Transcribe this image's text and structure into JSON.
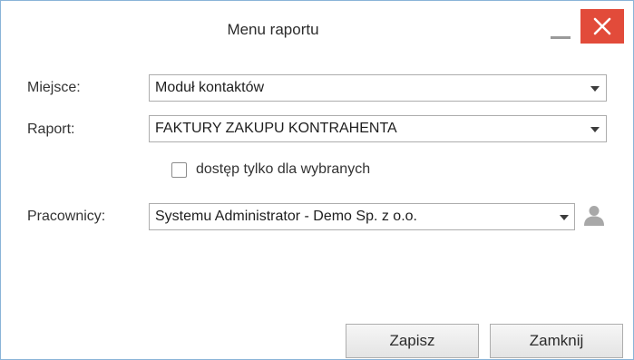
{
  "window": {
    "title": "Menu raportu"
  },
  "form": {
    "miejsce": {
      "label": "Miejsce:",
      "value": "Moduł kontaktów"
    },
    "raport": {
      "label": "Raport:",
      "value": "FAKTURY ZAKUPU KONTRAHENTA"
    },
    "access_checkbox": {
      "label": "dostęp tylko dla wybranych",
      "checked": false
    },
    "pracownicy": {
      "label": "Pracownicy:",
      "value": "Systemu Administrator - Demo Sp. z o.o.",
      "icon": "user-icon"
    }
  },
  "buttons": {
    "save": "Zapisz",
    "close": "Zamknij"
  },
  "colors": {
    "close_button": "#e24b3a",
    "window_border": "#8ab4d8"
  }
}
